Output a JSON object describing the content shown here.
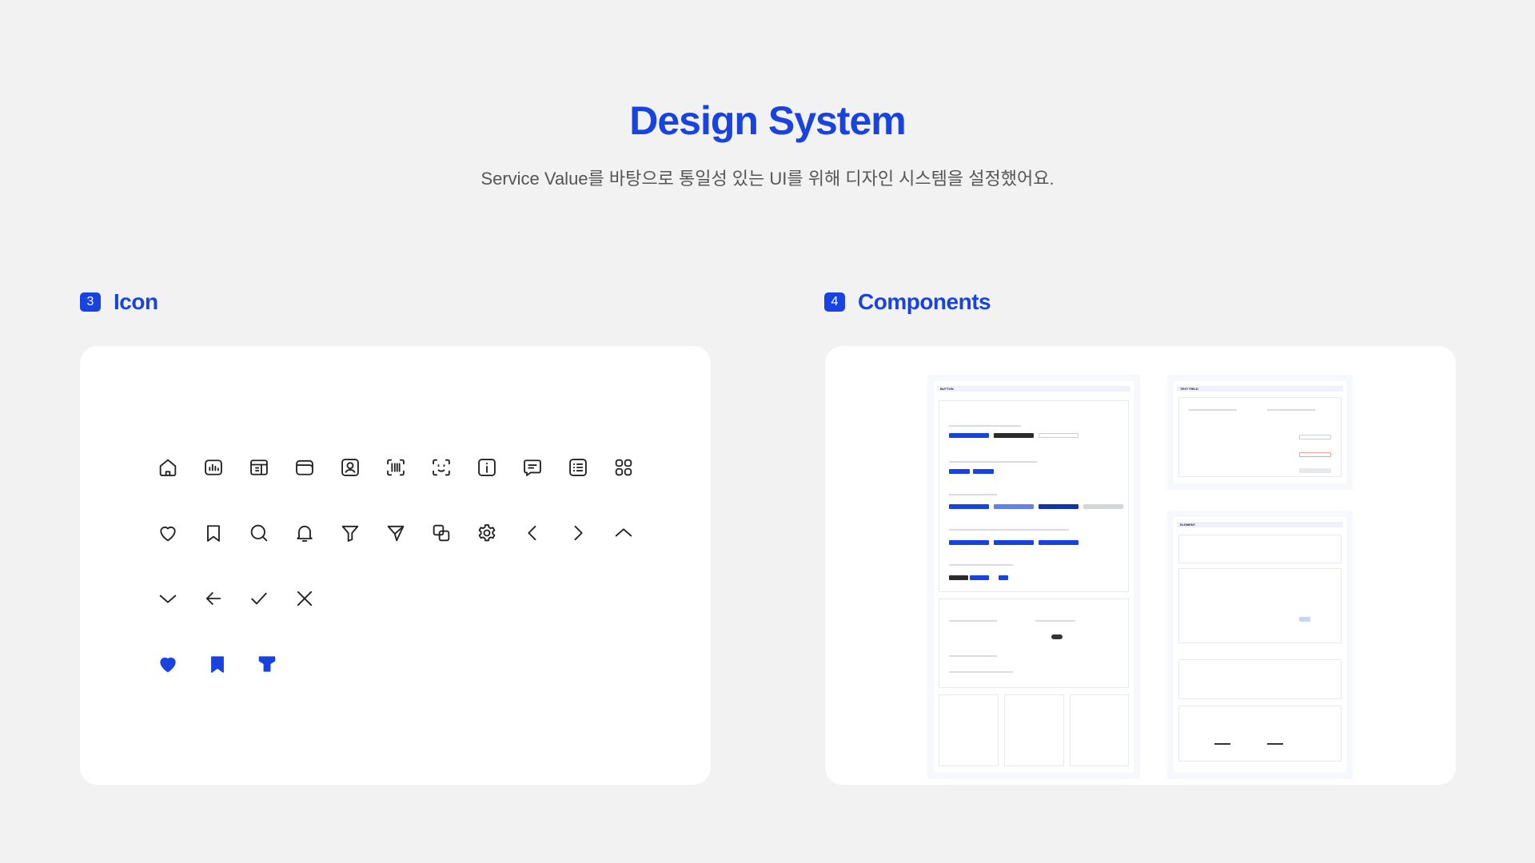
{
  "header": {
    "title": "Design System",
    "subtitle": "Service Value를 바탕으로 통일성 있는 UI를 위해 디자인 시스템을 설정했어요."
  },
  "sections": {
    "icon": {
      "number": "3",
      "label": "Icon"
    },
    "components": {
      "number": "4",
      "label": "Components"
    }
  },
  "thumbnails": {
    "button": "BUTTON",
    "text_field": "TEXT FIELD",
    "element": "ELEMENT"
  },
  "colors": {
    "accent": "#1843e0",
    "icon_stroke": "#222222",
    "background": "#f2f2f3",
    "panel": "#ffffff"
  },
  "icons": [
    [
      "home-icon",
      "chart-icon",
      "layout-icon",
      "wallet-icon",
      "profile-icon",
      "barcode-icon",
      "face-scan-icon",
      "info-icon",
      "chat-icon",
      "list-icon",
      "grid-icon"
    ],
    [
      "heart-icon",
      "bookmark-icon",
      "search-icon",
      "bell-icon",
      "filter-icon",
      "send-icon",
      "copy-icon",
      "gear-icon",
      "chevron-left-icon",
      "chevron-right-icon",
      "chevron-up-icon"
    ],
    [
      "chevron-down-icon",
      "arrow-left-icon",
      "check-icon",
      "close-icon"
    ],
    [
      "heart-filled-icon",
      "bookmark-filled-icon",
      "filter-filled-icon"
    ]
  ]
}
